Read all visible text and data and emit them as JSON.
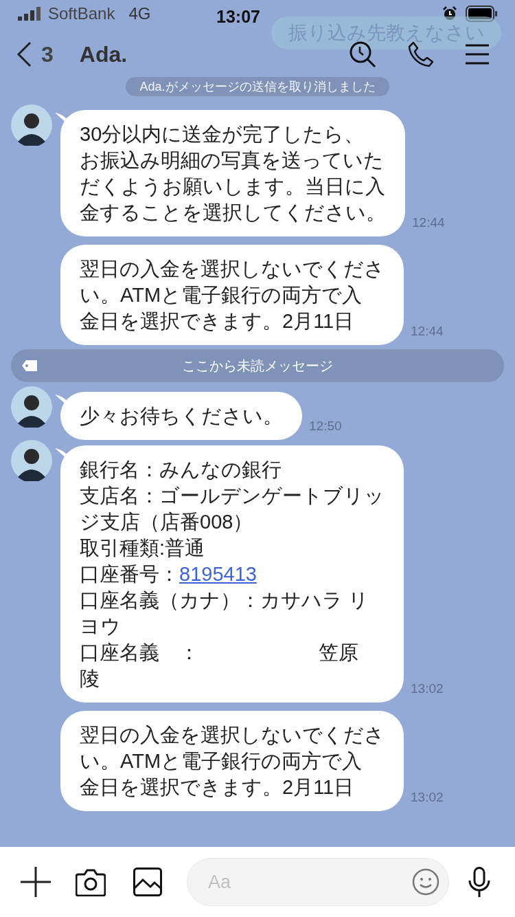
{
  "status_bar": {
    "carrier": "SoftBank",
    "network": "4G",
    "time": "13:07"
  },
  "faded_sent_message": "振り込み先教えなさい",
  "header": {
    "back_count": "3",
    "title": "Ada."
  },
  "system_notice": "Ada.がメッセージの送信を取り消しました",
  "messages": [
    {
      "kind": "message",
      "avatar": true,
      "lines": [
        {
          "text": "30分以内に送金が完了したら、"
        },
        {
          "text": "お振込み明細の写真を送っていた"
        },
        {
          "text": "だくようお願いします。当日に入"
        },
        {
          "text": "金することを選択してください。"
        }
      ],
      "time": "12:44"
    },
    {
      "kind": "message",
      "avatar": false,
      "lines": [
        {
          "text": "翌日の入金を選択しないでくださ"
        },
        {
          "text": "い。ATMと電子銀行の両方で入"
        },
        {
          "text": "金日を選択できます。2月11日"
        }
      ],
      "time": "12:44"
    },
    {
      "kind": "divider",
      "text": "ここから未読メッセージ"
    },
    {
      "kind": "message",
      "avatar": true,
      "lines": [
        {
          "text": "少々お待ちください。"
        }
      ],
      "time": "12:50"
    },
    {
      "kind": "message",
      "avatar": true,
      "lines": [
        {
          "text": "銀行名：みんなの銀行"
        },
        {
          "text": "支店名：ゴールデンゲートブリッ"
        },
        {
          "text": "ジ支店（店番008）"
        },
        {
          "text": "取引種類:普通"
        },
        {
          "text": "口座番号：",
          "link": "8195413"
        },
        {
          "text": "口座名義（カナ）：カサハラ リ"
        },
        {
          "text": "ヨウ"
        },
        {
          "text": "口座名義　：　　　　　　笠原"
        },
        {
          "text": "陵"
        }
      ],
      "time": "13:02"
    },
    {
      "kind": "message",
      "avatar": false,
      "lines": [
        {
          "text": "翌日の入金を選択しないでくださ"
        },
        {
          "text": "い。ATMと電子銀行の両方で入"
        },
        {
          "text": "金日を選択できます。2月11日"
        }
      ],
      "time": "13:02"
    }
  ],
  "input": {
    "placeholder": "Aa"
  }
}
